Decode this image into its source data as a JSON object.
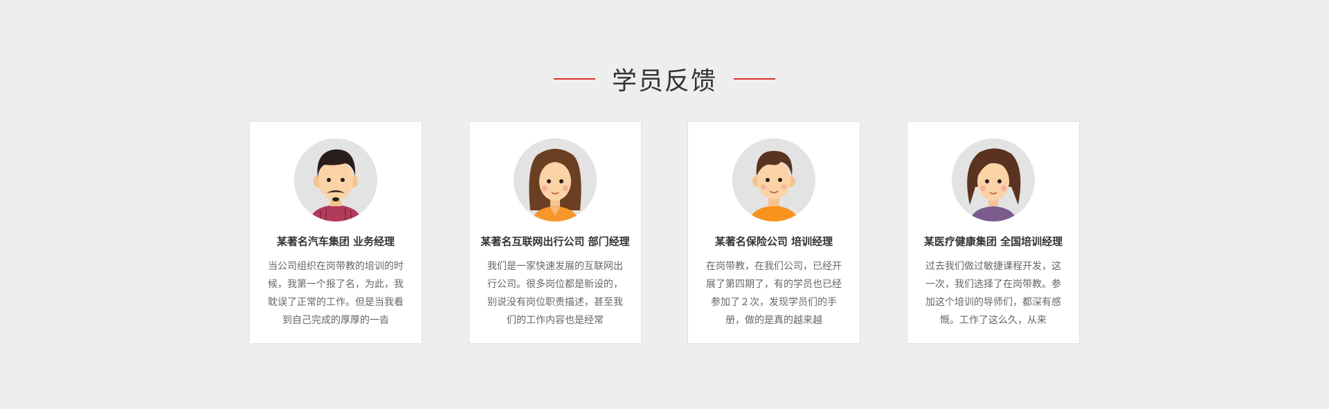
{
  "section": {
    "title": "学员反馈"
  },
  "colors": {
    "accent": "#d6302a",
    "background": "#eeeeee",
    "card": "#ffffff"
  },
  "testimonials": [
    {
      "avatar": "man-with-mustache-avatar",
      "name": "某著名汽车集团 业务经理",
      "quote": "当公司组织在岗带教的培训的时候，我第一个报了名，为此，我耽误了正常的工作。但是当我看到自己完成的厚厚的一沓"
    },
    {
      "avatar": "woman-long-hair-avatar",
      "name": "某著名互联网出行公司 部门经理",
      "quote": "我们是一家快速发展的互联网出行公司。很多岗位都是新设的，别说没有岗位职责描述，甚至我们的工作内容也是经常"
    },
    {
      "avatar": "young-man-avatar",
      "name": "某著名保险公司 培训经理",
      "quote": "在岗带教，在我们公司，已经开展了第四期了，有的学员也已经参加了２次，发现学员们的手册，做的是真的越来越"
    },
    {
      "avatar": "woman-wavy-hair-avatar",
      "name": "某医疗健康集团 全国培训经理",
      "quote": "过去我们做过敏捷课程开发，这一次，我们选择了在岗带教。参加这个培训的导师们，都深有感慨。工作了这么久，从来"
    }
  ]
}
